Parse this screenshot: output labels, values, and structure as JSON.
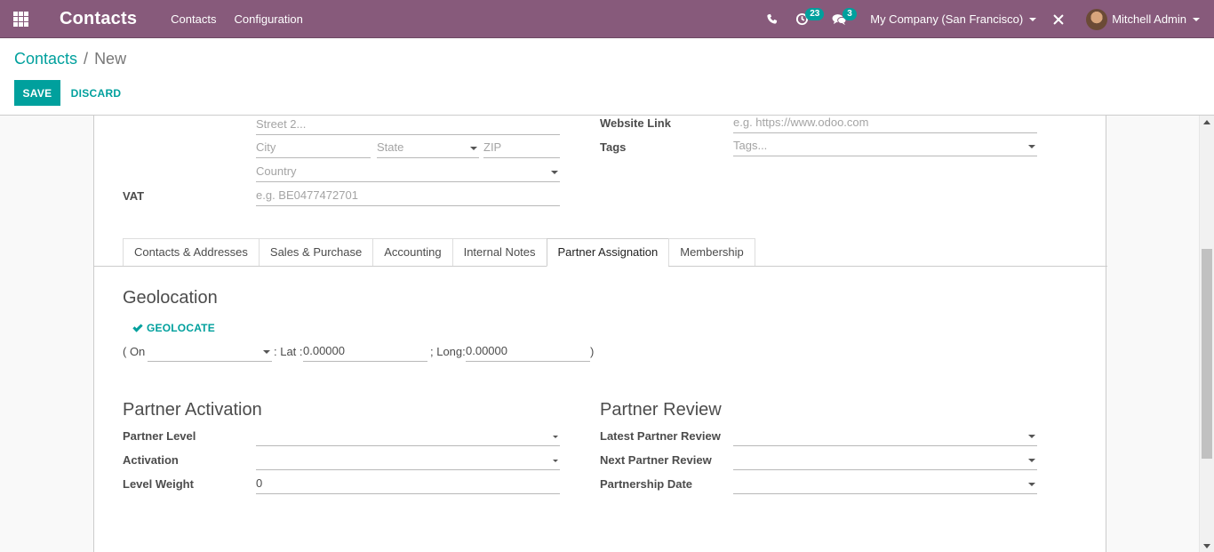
{
  "navbar": {
    "app_name": "Contacts",
    "menu": [
      "Contacts",
      "Configuration"
    ],
    "activity_badge": "23",
    "messages_badge": "3",
    "company": "My Company (San Francisco)",
    "user": "Mitchell Admin",
    "color": "#875a7b"
  },
  "breadcrumb": {
    "parent": "Contacts",
    "separator": "/",
    "current": "New"
  },
  "buttons": {
    "save": "SAVE",
    "discard": "DISCARD"
  },
  "address": {
    "street2_placeholder": "Street 2...",
    "city_placeholder": "City",
    "state_placeholder": "State",
    "zip_placeholder": "ZIP",
    "country_placeholder": "Country",
    "vat_label": "VAT",
    "vat_placeholder": "e.g. BE0477472701"
  },
  "right_fields": {
    "website_label": "Website Link",
    "website_placeholder": "e.g. https://www.odoo.com",
    "tags_label": "Tags",
    "tags_placeholder": "Tags..."
  },
  "tabs": [
    "Contacts & Addresses",
    "Sales & Purchase",
    "Accounting",
    "Internal Notes",
    "Partner Assignation",
    "Membership"
  ],
  "active_tab": "Partner Assignation",
  "geolocation": {
    "title": "Geolocation",
    "button": "GEOLOCATE",
    "on_prefix": "( On",
    "lat_label": ": Lat :",
    "lat_value": "0.00000",
    "long_label": "; Long:",
    "long_value": "0.00000",
    "close": ")"
  },
  "partner_activation": {
    "title": "Partner Activation",
    "level_label": "Partner Level",
    "activation_label": "Activation",
    "weight_label": "Level Weight",
    "weight_value": "0"
  },
  "partner_review": {
    "title": "Partner Review",
    "latest_label": "Latest Partner Review",
    "next_label": "Next Partner Review",
    "date_label": "Partnership Date"
  },
  "accent_color": "#00a09d"
}
